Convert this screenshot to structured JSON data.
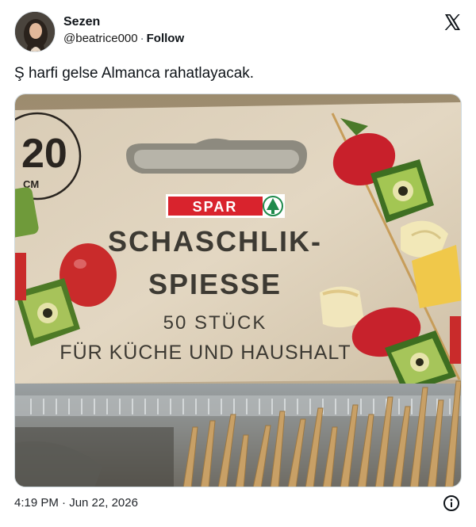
{
  "author": {
    "display_name": "Sezen",
    "handle": "@beatrice000",
    "follow_label": "Follow",
    "separator": "·"
  },
  "tweet": {
    "text": "Ş harfi gelse Almanca rahatlayacak.",
    "timestamp": "4:19 PM · Jun 22, 2026"
  },
  "photo": {
    "size_badge_number": "20",
    "size_badge_unit": "CM",
    "brand": "SPAR",
    "title_line1": "SCHASCHLIK-",
    "title_line2": "SPIESSE",
    "count": "50 STÜCK",
    "usage": "FÜR KÜCHE UND HAUSHALT"
  },
  "icons": {
    "platform": "x-logo-icon",
    "info": "info-icon"
  },
  "colors": {
    "text": "#0f1419",
    "muted": "#536471",
    "brand_red": "#d9232d",
    "brand_green": "#1e8a4b"
  }
}
